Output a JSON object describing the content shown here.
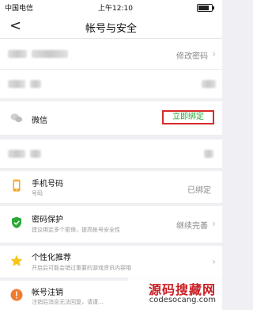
{
  "status_bar": {
    "carrier": "中国电信",
    "time": "上午12:10",
    "battery_level": 0.8
  },
  "header": {
    "back_glyph": "<",
    "title": "帐号与安全"
  },
  "rows": {
    "password": {
      "action": "修改密码"
    },
    "wechat": {
      "label": "微信",
      "action": "立即绑定"
    },
    "phone": {
      "label": "手机号码",
      "sublabel": "号码",
      "status": "已绑定"
    },
    "password_protect": {
      "label": "密码保护",
      "sublabel": "建议绑定多个密保，提高帐号安全性",
      "action": "继续完善"
    },
    "recommend": {
      "label": "个性化推荐",
      "sublabel": "开启后可能会错过重要的游戏资讯内容哦"
    },
    "cancel": {
      "label": "帐号注销",
      "sublabel": "注销后消息无法回复，请谨..."
    }
  },
  "colors": {
    "accent_green": "#2aa836",
    "highlight_red": "#d82a2a",
    "chevron": "#bbbbbb"
  },
  "icons": {
    "wechat": "wechat-icon",
    "phone": "phone-icon",
    "shield": "shield-check-icon",
    "star": "star-icon",
    "cancel": "alert-icon"
  },
  "watermark": {
    "title": "源码搜藏网",
    "url": "codesocang.com"
  }
}
